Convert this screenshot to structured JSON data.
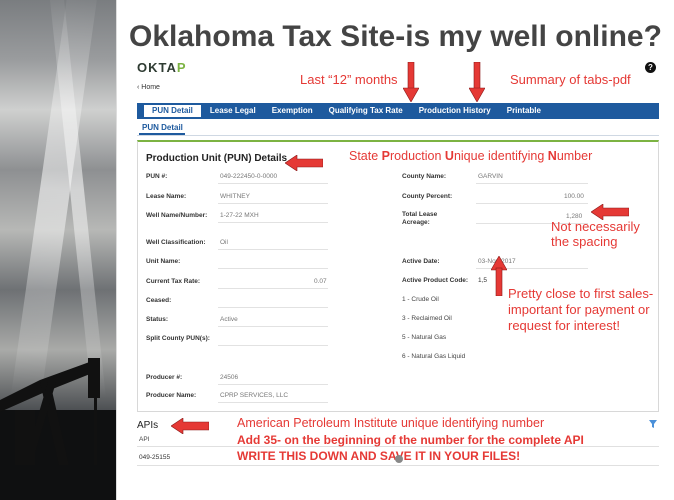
{
  "slide": {
    "title": "Oklahoma Tax Site-is my well online?"
  },
  "app": {
    "logo_prefix": "OKTA",
    "logo_suffix": "P",
    "help_glyph": "?",
    "breadcrumb": "‹  Home"
  },
  "tabs": [
    "PUN Detail",
    "Lease Legal",
    "Exemption",
    "Qualifying Tax Rate",
    "Production History",
    "Printable"
  ],
  "subtab": "PUN Detail",
  "panel": {
    "title": "Production Unit (PUN) Details",
    "left": [
      {
        "label": "PUN #:",
        "value": "049-222450-0-0000"
      },
      {
        "label": "Lease Name:",
        "value": "WHITNEY"
      },
      {
        "label": "Well Name/Number:",
        "value": "1-27-22 MXH"
      },
      {
        "label": "Well Classification:",
        "value": "Oil"
      },
      {
        "label": "Unit Name:",
        "value": ""
      },
      {
        "label": "Current Tax Rate:",
        "value": "0.07"
      },
      {
        "label": "Ceased:",
        "value": ""
      },
      {
        "label": "Status:",
        "value": "Active"
      },
      {
        "label": "Split County PUN(s):",
        "value": ""
      },
      {
        "label": "Producer #:",
        "value": "24506"
      },
      {
        "label": "Producer Name:",
        "value": "CPRP SERVICES, LLC"
      }
    ],
    "right": [
      {
        "label": "County Name:",
        "value": "GARVIN"
      },
      {
        "label": "County Percent:",
        "value": "100.00"
      },
      {
        "label": "Total Lease\nAcreage:",
        "value": "1,280"
      },
      {
        "label": "Active Date:",
        "value": "03-Nov-2017"
      },
      {
        "label": "Active Product Code:",
        "value": "1,5"
      }
    ],
    "product_codes": [
      "1 - Crude Oil",
      "3 - Reclaimed Oil",
      "5 - Natural Gas",
      "6 - Natural Gas Liquid"
    ]
  },
  "apis": {
    "title": "APIs",
    "column": "API",
    "value": "049-25155"
  },
  "annotations": {
    "last12": "Last “12” months",
    "summary": "Summary of tabs-pdf",
    "state_pun": {
      "p1": "State ",
      "b1": "P",
      "p2": "roduction ",
      "b2": "U",
      "p3": "nique identifying ",
      "b3": "N",
      "p4": "umber"
    },
    "spacing": "Not necessarily\nthe spacing",
    "sales": "Pretty close to first sales-\nimportant for payment or\nrequest for interest!",
    "api_def": "American Petroleum Institute unique identifying number",
    "api_add": "Add 35- on the beginning of the number for the complete API",
    "write_down": "WRITE THIS DOWN AND SAVE IT IN YOUR FILES!"
  },
  "colors": {
    "tab_bar": "#1e5a9e",
    "accent_green": "#7cb342",
    "annotation_red": "#e53935"
  }
}
